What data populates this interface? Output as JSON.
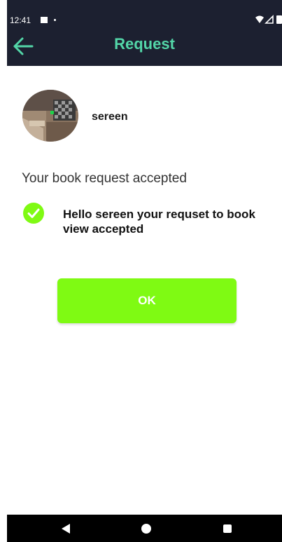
{
  "status_bar": {
    "time": "12:41"
  },
  "header": {
    "title": "Request",
    "title_color": "#53d6a8",
    "background": "#1c2030",
    "back_icon": "arrow-left-icon"
  },
  "user": {
    "name": "sereen"
  },
  "main": {
    "heading": "Your book request accepted",
    "check_icon": "check-circle-icon",
    "check_color": "#7ffa13",
    "message": "Hello sereen your requset to book view accepted"
  },
  "ok_button": {
    "label": "OK",
    "color": "#7ffa13"
  },
  "nav_bar": {
    "back_icon": "triangle-back-icon",
    "home_icon": "circle-home-icon",
    "recent_icon": "square-recent-icon"
  }
}
